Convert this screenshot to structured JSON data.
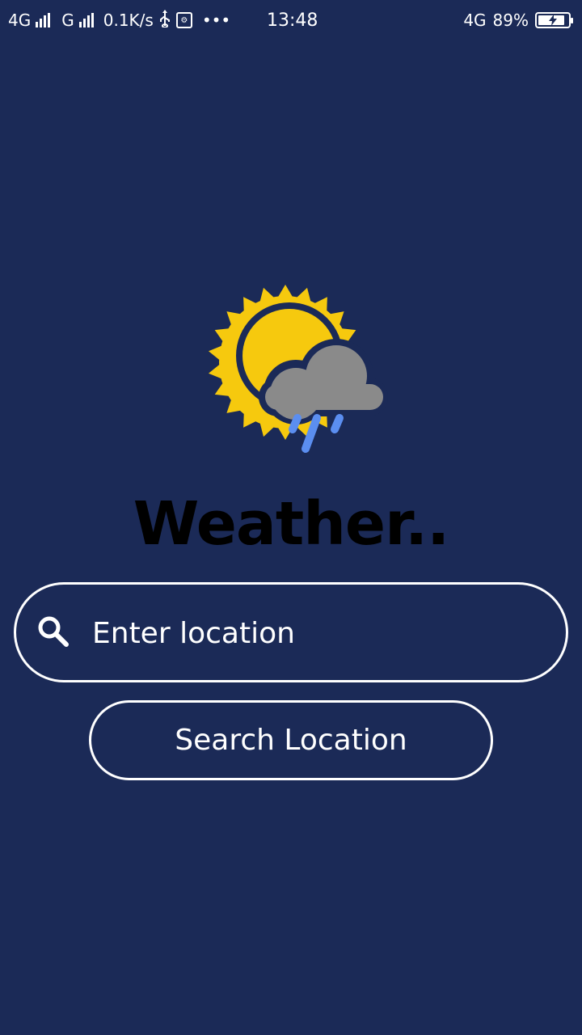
{
  "status_bar": {
    "network_1": "4G",
    "network_2": "G",
    "speed": "0.1K/s",
    "more": "•••",
    "time": "13:48",
    "network_right": "4G",
    "battery_percent": "89%",
    "battery_level": 0.89,
    "charging": true
  },
  "app": {
    "title": "Weather..",
    "logo_icon": "sun-cloud-rain-icon"
  },
  "search": {
    "placeholder": "Enter location",
    "value": "",
    "icon": "search-icon"
  },
  "search_button": {
    "label": "Search Location"
  },
  "colors": {
    "background": "#1b2a57",
    "sun": "#f6c90e",
    "cloud": "#8a8a8a",
    "rain": "#5b8ef0",
    "title": "#000000",
    "outline": "#ffffff"
  }
}
